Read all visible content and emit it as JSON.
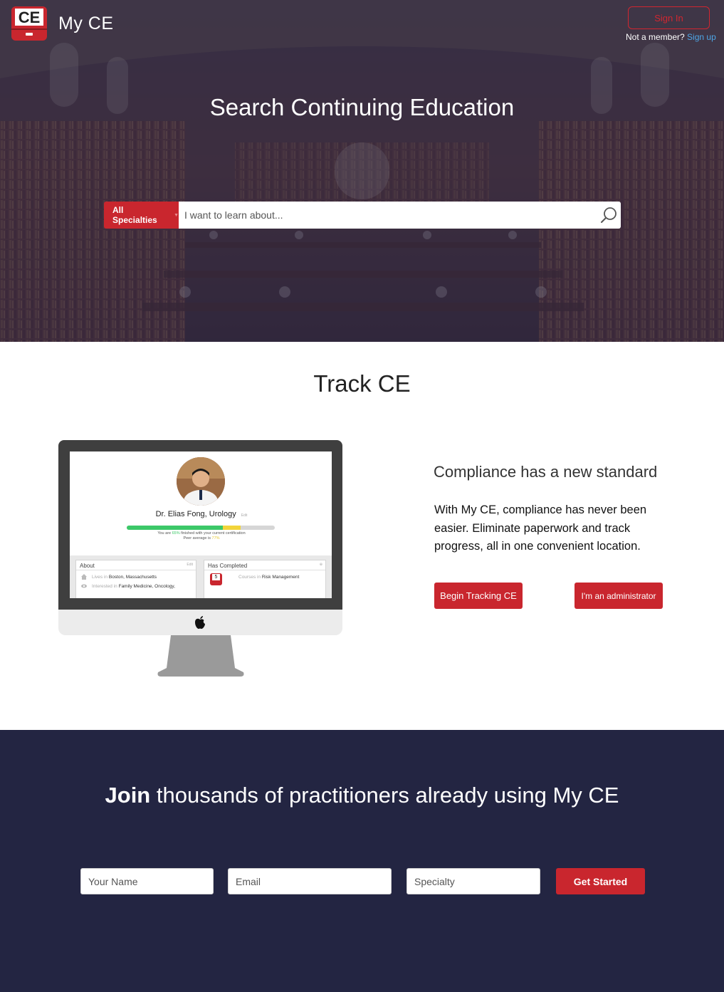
{
  "header": {
    "brand": "My CE",
    "logo_text": "CE",
    "signin_label": "Sign In",
    "member_prompt": "Not a member?",
    "signup_label": "Sign up"
  },
  "hero": {
    "title": "Search Continuing Education",
    "specialty_label": "All Specialties",
    "search_placeholder": "I want to learn about..."
  },
  "track": {
    "title": "Track CE",
    "heading": "Compliance has a new standard",
    "body": "With My CE, compliance has never been easier. Eliminate paperwork and track progress, all in one convenient location.",
    "begin_button": "Begin Tracking CE",
    "admin_button": "I'm an administrator",
    "mockup": {
      "doctor_name": "Dr. Elias Fong, Urology",
      "edit_label": "Edit",
      "progress_percent": 65,
      "peer_average_percent": 77,
      "progress_prefix": "You are",
      "progress_value": "65%",
      "progress_suffix": "finished with your current certification",
      "peer_prefix": "Peer average is",
      "peer_value": "77%",
      "about_title": "About",
      "lives_in_prefix": "Lives in",
      "lives_in_value": "Boston, Massachusetts",
      "interested_prefix": "Interested in",
      "interested_value": "Family Medicine, Oncology,",
      "completed_title": "Has Completed",
      "course_count": "5",
      "courses_prefix": "Courses in",
      "courses_value": "Risk Management"
    }
  },
  "join": {
    "title_bold": "Join",
    "title_rest": "thousands of practitioners already using My CE",
    "name_placeholder": "Your Name",
    "email_placeholder": "Email",
    "specialty_placeholder": "Specialty",
    "submit_label": "Get Started"
  },
  "colors": {
    "brand_red": "#c9262e",
    "navy": "#232542",
    "link_blue": "#4ea6e6"
  },
  "icons": [
    "ce-logo-icon",
    "search-icon",
    "caret-down-icon",
    "apple-icon",
    "home-icon",
    "eye-icon"
  ]
}
